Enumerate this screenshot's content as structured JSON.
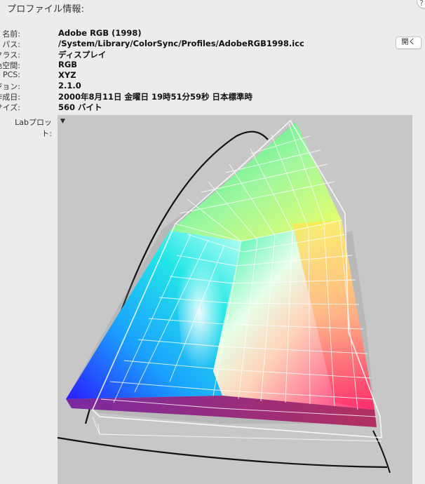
{
  "panel": {
    "title": "プロファイル情報:",
    "help_label": "?"
  },
  "info": {
    "rows": [
      {
        "label": "名前:",
        "value": "Adobe RGB (1998)"
      },
      {
        "label": "パス:",
        "value": "/System/Library/ColorSync/Profiles/AdobeRGB1998.icc"
      },
      {
        "label": "クラス:",
        "value": "ディスプレイ"
      },
      {
        "label": "色空間:",
        "value": "RGB"
      },
      {
        "label": "PCS:",
        "value": "XYZ"
      },
      {
        "label": "バージョン:",
        "value": "2.1.0"
      },
      {
        "label": "作成日:",
        "value": "2000年8月11日 金曜日 19時51分59秒 日本標準時"
      },
      {
        "label": "サイズ:",
        "value": "560 バイト"
      }
    ],
    "open_button": "開く"
  },
  "lab_plot": {
    "label": "Labプロット:",
    "menu_icon": "triangle-down-icon"
  },
  "colors": {
    "background": "#ececec",
    "plot_background": "#c7c7c7"
  }
}
